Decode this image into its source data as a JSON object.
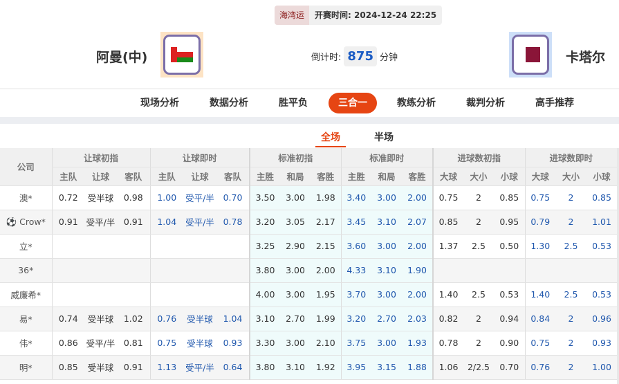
{
  "header": {
    "league": "海湾运",
    "kickoff_label": "开赛时间:",
    "kickoff_time": "2024-12-24 22:25",
    "home_team": "阿曼(中)",
    "away_team": "卡塔尔",
    "countdown_label": "倒计时:",
    "countdown_value": "875",
    "countdown_unit": "分钟"
  },
  "nav": {
    "items": [
      "现场分析",
      "数据分析",
      "胜平负",
      "三合一",
      "教练分析",
      "裁判分析",
      "高手推荐"
    ],
    "active": "三合一"
  },
  "subtabs": {
    "items": [
      "全场",
      "半场"
    ],
    "active": "全场"
  },
  "table": {
    "company_header": "公司",
    "groups": [
      "让球初指",
      "让球即时",
      "标准初指",
      "标准即时",
      "进球数初指",
      "进球数即时"
    ],
    "subheaders": [
      [
        "主队",
        "让球",
        "客队"
      ],
      [
        "主队",
        "让球",
        "客队"
      ],
      [
        "主胜",
        "和局",
        "客胜"
      ],
      [
        "主胜",
        "和局",
        "客胜"
      ],
      [
        "大球",
        "大小",
        "小球"
      ],
      [
        "大球",
        "大小",
        "小球"
      ]
    ],
    "rows": [
      {
        "company": "澳*",
        "cells": [
          "0.72",
          "受半球",
          "0.98",
          "1.00",
          "受平/半",
          "0.70",
          "3.50",
          "3.00",
          "1.98",
          "3.40",
          "3.00",
          "2.00",
          "0.75",
          "2",
          "0.85",
          "0.75",
          "2",
          "0.85"
        ]
      },
      {
        "company": "Crow*",
        "icon": "soccer-ball",
        "cells": [
          "0.91",
          "受平/半",
          "0.91",
          "1.04",
          "受平/半",
          "0.78",
          "3.20",
          "3.05",
          "2.17",
          "3.45",
          "3.10",
          "2.07",
          "0.85",
          "2",
          "0.95",
          "0.79",
          "2",
          "1.01"
        ]
      },
      {
        "company": "立*",
        "cells": [
          "",
          "",
          "",
          "",
          "",
          "",
          "3.25",
          "2.90",
          "2.15",
          "3.60",
          "3.00",
          "2.00",
          "1.37",
          "2.5",
          "0.50",
          "1.30",
          "2.5",
          "0.53"
        ]
      },
      {
        "company": "36*",
        "cells": [
          "",
          "",
          "",
          "",
          "",
          "",
          "3.80",
          "3.00",
          "2.00",
          "4.33",
          "3.10",
          "1.90",
          "",
          "",
          "",
          "",
          "",
          ""
        ]
      },
      {
        "company": "威廉希*",
        "cells": [
          "",
          "",
          "",
          "",
          "",
          "",
          "4.00",
          "3.00",
          "1.95",
          "3.70",
          "3.00",
          "2.00",
          "1.40",
          "2.5",
          "0.53",
          "1.40",
          "2.5",
          "0.53"
        ]
      },
      {
        "company": "易*",
        "cells": [
          "0.74",
          "受半球",
          "1.02",
          "0.76",
          "受半球",
          "1.04",
          "3.10",
          "2.70",
          "1.99",
          "3.20",
          "2.70",
          "2.03",
          "0.82",
          "2",
          "0.94",
          "0.84",
          "2",
          "0.96"
        ]
      },
      {
        "company": "伟*",
        "cells": [
          "0.86",
          "受平/半",
          "0.81",
          "0.75",
          "受半球",
          "0.93",
          "3.30",
          "3.00",
          "2.10",
          "3.75",
          "3.00",
          "1.93",
          "0.78",
          "2",
          "0.90",
          "0.75",
          "2",
          "0.93"
        ]
      },
      {
        "company": "明*",
        "cells": [
          "0.85",
          "受半球",
          "0.91",
          "1.13",
          "受平/半",
          "0.64",
          "3.80",
          "3.10",
          "1.92",
          "3.95",
          "3.15",
          "1.88",
          "1.06",
          "2/2.5",
          "0.70",
          "0.76",
          "2",
          "1.00"
        ]
      }
    ]
  },
  "colors": {
    "accent": "#e64513",
    "live_odds": "#1f57ad",
    "countdown": "#1a5bc4"
  }
}
